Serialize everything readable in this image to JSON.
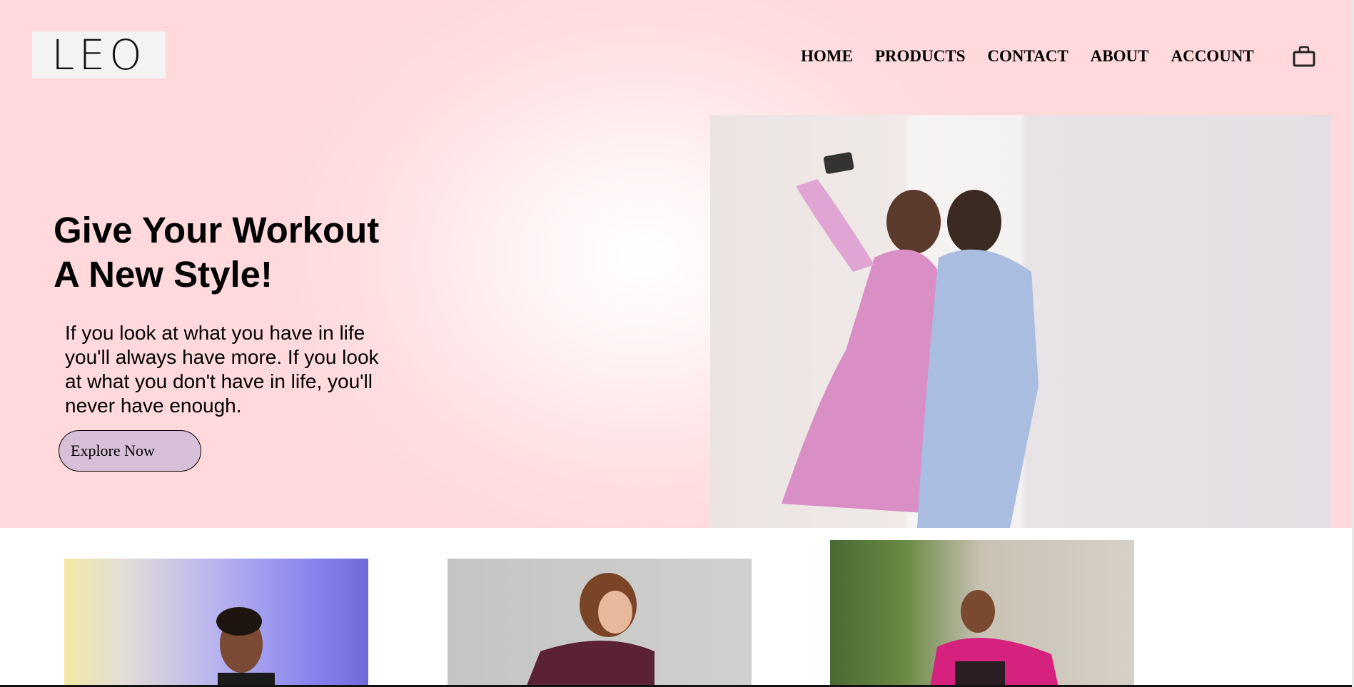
{
  "brand": {
    "logo_text": "LEO"
  },
  "nav": {
    "items": [
      "HOME",
      "PRODUCTS",
      "CONTACT",
      "ABOUT",
      "ACCOUNT"
    ],
    "cart_icon": "shopping-bag-icon"
  },
  "hero": {
    "heading_line1": "Give Your Workout",
    "heading_line2": "A New Style!",
    "text": "If you look at what you have in life you'll always have more. If you look at what you don't have in life, you'll never have enough.",
    "button_label": "Explore Now",
    "button_color": "#d8bfd8"
  }
}
